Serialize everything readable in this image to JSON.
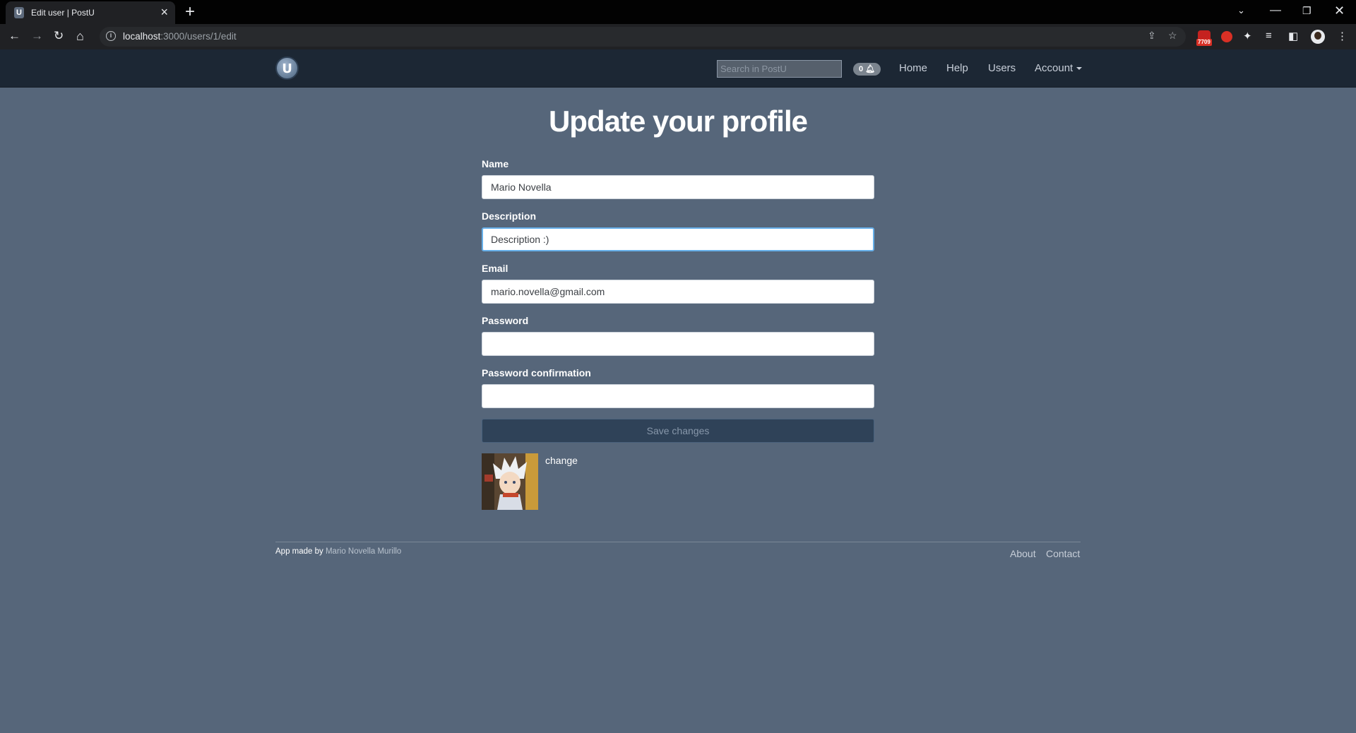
{
  "browser": {
    "tab_title": "Edit user | PostU",
    "tab_favicon_letter": "U",
    "url_host": "localhost",
    "url_path": ":3000/users/1/edit",
    "extension_badge": "7709"
  },
  "navbar": {
    "logo_letter": "U",
    "search_placeholder": "Search in PostU",
    "notification_count": "0",
    "links": [
      "Home",
      "Help",
      "Users",
      "Account"
    ]
  },
  "page": {
    "title": "Update your profile"
  },
  "form": {
    "name_label": "Name",
    "name_value": "Mario Novella",
    "description_label": "Description",
    "description_value": "Description :)",
    "email_label": "Email",
    "email_value": "mario.novella@gmail.com",
    "password_label": "Password",
    "password_value": "",
    "password_confirmation_label": "Password confirmation",
    "password_confirmation_value": "",
    "save_label": "Save changes",
    "change_label": "change"
  },
  "footer": {
    "made_by_prefix": "App made by",
    "author": "Mario Novella Murillo",
    "about": "About",
    "contact": "Contact"
  },
  "colors": {
    "page_background": "#56667a",
    "navbar_background": "#1c2734",
    "save_button": "#2f4258",
    "focus_ring": "#66afe9"
  },
  "icons": [
    "back-icon",
    "forward-icon",
    "reload-icon",
    "home-icon",
    "info-icon",
    "share-icon",
    "star-icon",
    "puzzle-icon",
    "media-icon",
    "sidebar-icon",
    "menu-icon",
    "bell-icon",
    "caret-down-icon"
  ]
}
